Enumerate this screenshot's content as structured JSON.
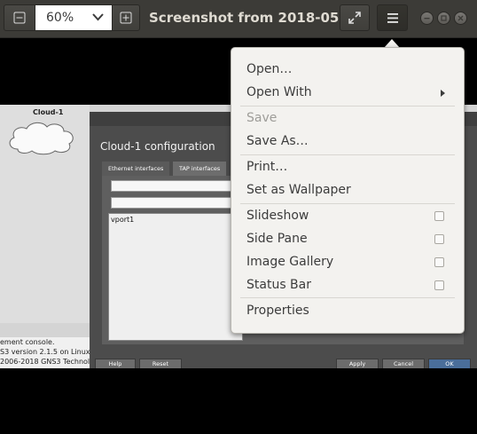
{
  "header": {
    "zoom_value": "60%",
    "title": "Screenshot from 2018-05-1…",
    "icons": {
      "zoom_out": "minus-icon",
      "zoom_dropdown": "chevron-down-icon",
      "zoom_in": "plus-icon",
      "fullscreen": "fullscreen-icon",
      "menu": "hamburger-menu-icon",
      "minimize": "minimize-icon",
      "maximize": "maximize-icon",
      "close": "close-icon"
    }
  },
  "image_content": {
    "cloud_label": "Cloud-1",
    "dialog_title": "Cloud-1 configuration",
    "tabs": [
      "Ethernet interfaces",
      "TAP interfaces"
    ],
    "interface_item": "vport1",
    "console_lines": [
      "ement console.",
      "S3 version 2.1.5 on Linux (",
      "2006-2018 GNS3 Technologies"
    ],
    "buttons": {
      "help": "Help",
      "reset": "Reset",
      "apply": "Apply",
      "cancel": "Cancel",
      "ok": "OK"
    }
  },
  "menu": {
    "open": "Open…",
    "open_with": "Open With",
    "save": "Save",
    "save_as": "Save As…",
    "print": "Print…",
    "set_wallpaper": "Set as Wallpaper",
    "slideshow": "Slideshow",
    "side_pane": "Side Pane",
    "image_gallery": "Image Gallery",
    "status_bar": "Status Bar",
    "properties": "Properties"
  },
  "toggles": {
    "slideshow": false,
    "side_pane": false,
    "image_gallery": false,
    "status_bar": false
  },
  "colors": {
    "headerbar": "#3c3b37",
    "menu_background": "#f3f2ef",
    "text": "#3c3c3c",
    "disabled_text": "#9e9d99"
  }
}
